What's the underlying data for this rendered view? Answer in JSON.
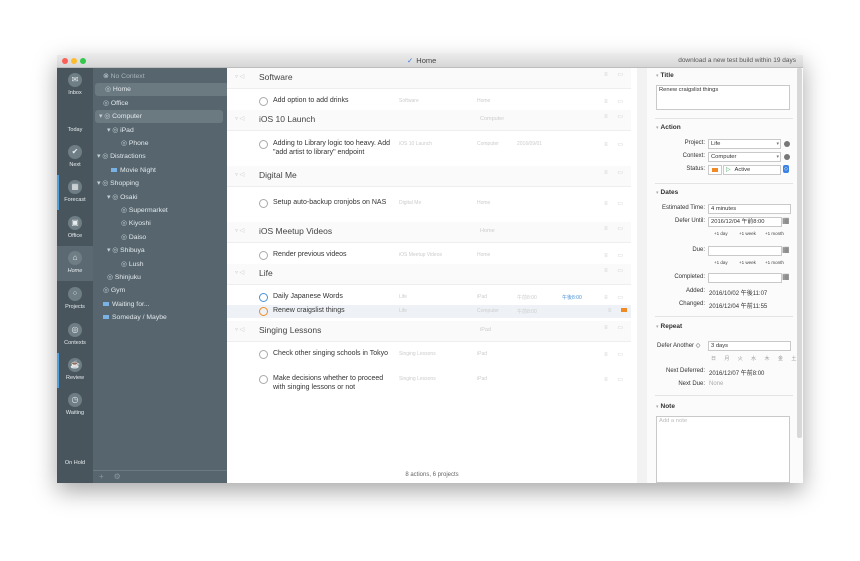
{
  "window": {
    "title": "Home",
    "notice": "download a new test build within 19 days"
  },
  "rail": [
    {
      "label": "Inbox",
      "glyph": "✉"
    },
    {
      "label": "Today",
      "glyph": ""
    },
    {
      "label": "Next",
      "glyph": "✔"
    },
    {
      "label": "Forecast",
      "glyph": "▦"
    },
    {
      "label": "Office",
      "glyph": "▣"
    },
    {
      "label": "Home",
      "glyph": "⌂"
    },
    {
      "label": "Projects",
      "glyph": "⁘"
    },
    {
      "label": "Contexts",
      "glyph": "◎"
    },
    {
      "label": "Review",
      "glyph": "☕"
    },
    {
      "label": "Waiting",
      "glyph": "◷"
    },
    {
      "label": "On Hold",
      "glyph": ""
    }
  ],
  "sidebar": [
    {
      "label": "No Context",
      "prefix": "⊗"
    },
    {
      "label": "Home",
      "prefix": "◎"
    },
    {
      "label": "Office",
      "prefix": "◎"
    },
    {
      "label": "Computer",
      "prefix": "▾ ◎"
    },
    {
      "label": "iPad",
      "prefix": "▾ ◎"
    },
    {
      "label": "Phone",
      "prefix": "◎"
    },
    {
      "label": "Distractions",
      "prefix": "▾ ◎"
    },
    {
      "label": "Movie Night",
      "prefix": ""
    },
    {
      "label": "Shopping",
      "prefix": "▾ ◎"
    },
    {
      "label": "Osaki",
      "prefix": "▾ ◎"
    },
    {
      "label": "Supermarket",
      "prefix": "◎"
    },
    {
      "label": "Kiyoshi",
      "prefix": "◎"
    },
    {
      "label": "Daiso",
      "prefix": "◎"
    },
    {
      "label": "Shibuya",
      "prefix": "▾ ◎"
    },
    {
      "label": "Lush",
      "prefix": "◎"
    },
    {
      "label": "Shinjuku",
      "prefix": "◎"
    },
    {
      "label": "Gym",
      "prefix": "◎"
    },
    {
      "label": "Waiting for...",
      "prefix": ""
    },
    {
      "label": "Someday / Maybe",
      "prefix": ""
    }
  ],
  "sidebar_footer": {
    "add": "+",
    "gear": "⚙"
  },
  "projects": [
    {
      "name": "Software",
      "context": "",
      "actions": [
        {
          "text": "Add option to add drinks",
          "project": "Software",
          "context": "Home"
        }
      ]
    },
    {
      "name": "iOS 10 Launch",
      "context": "Computer",
      "actions": [
        {
          "text": "Adding to Library logic too heavy. Add \"add artist to library\" endpoint",
          "project": "iOS 10 Launch",
          "context": "Computer",
          "date": "2016/09/01"
        }
      ]
    },
    {
      "name": "Digital Me",
      "context": "",
      "actions": [
        {
          "text": "Setup auto-backup cronjobs on NAS",
          "project": "Digital Me",
          "context": "Home"
        }
      ]
    },
    {
      "name": "iOS Meetup Videos",
      "context": "Home",
      "actions": [
        {
          "text": "Render previous videos",
          "project": "iOS Meetup Videos",
          "context": "Home"
        }
      ]
    },
    {
      "name": "Life",
      "context": "",
      "actions": [
        {
          "text": "Daily Japanese Words",
          "project": "Life",
          "context": "iPad",
          "time1": "午前8:00",
          "time2": "午後8:00"
        },
        {
          "text": "Renew craigslist things",
          "project": "Life",
          "context": "Computer",
          "time1": "午前8:00"
        }
      ]
    },
    {
      "name": "Singing Lessons",
      "context": "iPad",
      "actions": [
        {
          "text": "Check other singing schools in Tokyo",
          "project": "Singing Lessons",
          "context": "iPad"
        },
        {
          "text": "Make decisions whether to proceed with singing lessons or not",
          "project": "Singing Lessons",
          "context": "iPad"
        }
      ]
    }
  ],
  "content_footer": "8 actions, 6 projects",
  "inspector": {
    "title_section": "Title",
    "title_value": "Renew craigslist things",
    "action_section": "Action",
    "project_label": "Project:",
    "project_value": "Life",
    "context_label": "Context:",
    "context_value": "Computer",
    "status_label": "Status:",
    "status_value": "Active",
    "dates_section": "Dates",
    "estimated_label": "Estimated Time:",
    "estimated_value": "4 minutes",
    "defer_label": "Defer Until:",
    "defer_value": "2016/12/04 午前8:00",
    "due_label": "Due:",
    "due_value": "",
    "step_day": "+1 day",
    "step_week": "+1 week",
    "step_month": "+1 month",
    "completed_label": "Completed:",
    "completed_value": "",
    "added_label": "Added:",
    "added_value": "2016/10/02 午後11:07",
    "changed_label": "Changed:",
    "changed_value": "2016/12/04 午前11:55",
    "repeat_section": "Repeat",
    "repeat_mode": "Defer Another ◇",
    "repeat_value": "3 days",
    "weekdays": "日 月 火 水 木 金 土",
    "next_deferred_label": "Next Deferred:",
    "next_deferred_value": "2016/12/07 午前8:00",
    "next_due_label": "Next Due:",
    "next_due_value": "None",
    "note_section": "Note",
    "note_placeholder": "Add a note"
  }
}
